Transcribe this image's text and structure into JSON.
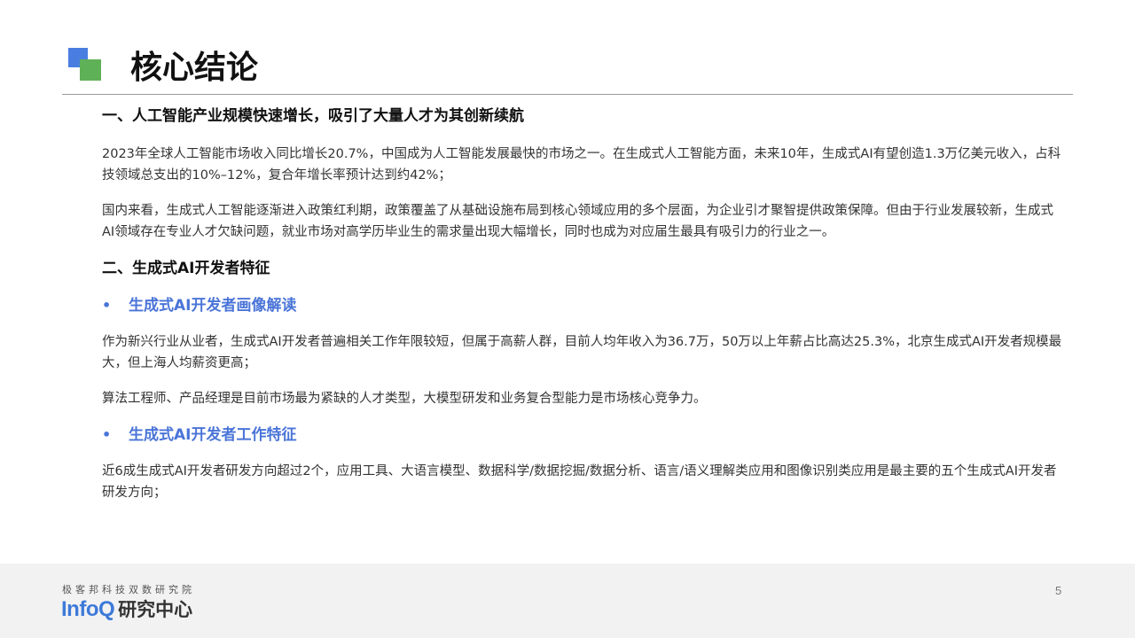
{
  "header": {
    "title": "核心结论"
  },
  "sections": {
    "s1": {
      "heading": "一、人工智能产业规模快速增长，吸引了大量人才为其创新续航",
      "p1": "2023年全球人工智能市场收入同比增长20.7%，中国成为人工智能发展最快的市场之一。在生成式人工智能方面，未来10年，生成式AI有望创造1.3万亿美元收入，占科技领域总支出的10%–12%，复合年增长率预计达到约42%；",
      "p2": "国内来看，生成式人工智能逐渐进入政策红利期，政策覆盖了从基础设施布局到核心领域应用的多个层面，为企业引才聚智提供政策保障。但由于行业发展较新，生成式AI领域存在专业人才欠缺问题，就业市场对高学历毕业生的需求量出现大幅增长，同时也成为对应届生最具有吸引力的行业之一。"
    },
    "s2": {
      "heading": "二、生成式AI开发者特征",
      "sub1": {
        "bullet": "•",
        "title": "生成式AI开发者画像解读",
        "p1": "作为新兴行业从业者，生成式AI开发者普遍相关工作年限较短，但属于高薪人群，目前人均年收入为36.7万，50万以上年薪占比高达25.3%，北京生成式AI开发者规模最大，但上海人均薪资更高；",
        "p2": "算法工程师、产品经理是目前市场最为紧缺的人才类型，大模型研发和业务复合型能力是市场核心竞争力。"
      },
      "sub2": {
        "bullet": "•",
        "title": "生成式AI开发者工作特征",
        "p1": "近6成生成式AI开发者研发方向超过2个，应用工具、大语言模型、数据科学/数据挖掘/数据分析、语言/语义理解类应用和图像识别类应用是最主要的五个生成式AI开发者研发方向；"
      }
    }
  },
  "footer": {
    "tagline": "极客邦科技双数研究院",
    "brand_en": "InfoQ",
    "brand_zh": "研究中心",
    "page_number": "5"
  },
  "colors": {
    "accent_blue": "#4a74d8",
    "logo_blue": "#4a7de0",
    "logo_green": "#5fb157",
    "footer_bg": "#f2f2f2"
  }
}
